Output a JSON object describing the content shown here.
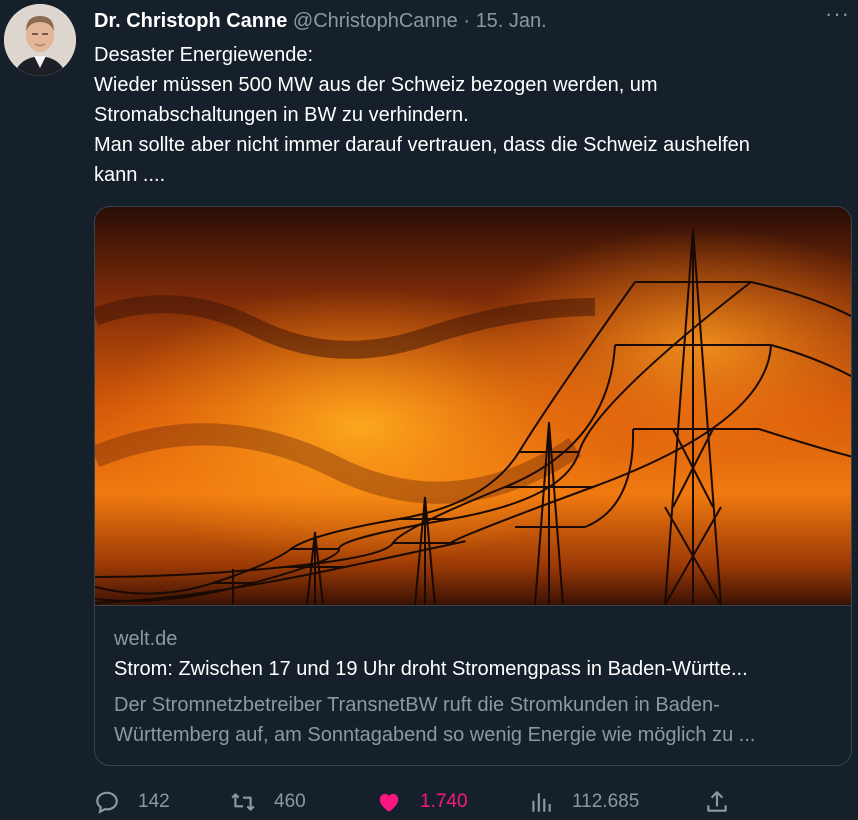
{
  "tweet": {
    "author_name": "Dr. Christoph Canne",
    "author_handle": "@ChristophCanne",
    "separator": "·",
    "date": "15. Jan.",
    "more_label": "···",
    "text_lines": [
      "Desaster Energiewende:",
      "Wieder müssen 500 MW aus der Schweiz bezogen werden, um",
      "Stromabschaltungen in BW zu verhindern.",
      "Man sollte aber nicht immer darauf vertrauen, dass die Schweiz aushelfen",
      "kann ...."
    ]
  },
  "card": {
    "image_alt": "Strommasten vor orange glühendem Himmel",
    "domain": "welt.de",
    "title": "Strom: Zwischen 17 und 19 Uhr droht Stromengpass in Baden-Württe...",
    "description_lines": [
      "Der Stromnetzbetreiber TransnetBW ruft die Stromkunden in Baden-",
      "Württemberg auf, am Sonntagabend so wenig Energie wie möglich zu ..."
    ]
  },
  "actions": {
    "reply": {
      "icon": "reply-icon",
      "count": "142"
    },
    "retweet": {
      "icon": "retweet-icon",
      "count": "460"
    },
    "like": {
      "icon": "heart-icon",
      "count": "1.740",
      "color": "#f91880"
    },
    "views": {
      "icon": "analytics-icon",
      "count": "112.685"
    },
    "share": {
      "icon": "share-icon"
    }
  },
  "colors": {
    "background": "#15202b",
    "secondary_text": "#8b98a5",
    "border": "#38444d",
    "like": "#f91880"
  }
}
